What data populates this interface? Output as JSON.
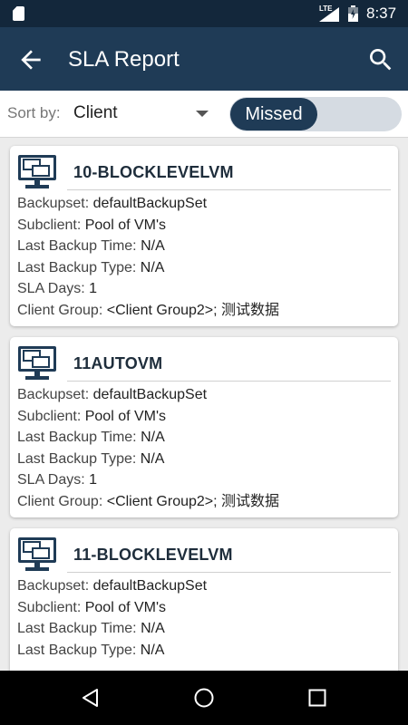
{
  "status_bar": {
    "network": "LTE",
    "time": "8:37"
  },
  "header": {
    "title": "SLA Report",
    "back_icon": "arrow-left-icon",
    "search_icon": "search-icon"
  },
  "sort": {
    "label": "Sort by:",
    "value": "Client",
    "toggle_label": "Missed"
  },
  "colors": {
    "primary": "#1f3b56",
    "status_bar": "#13273b",
    "toggle_track": "#d5dbe2"
  },
  "labels": {
    "backupset": "Backupset:",
    "subclient": "Subclient:",
    "last_backup_time": "Last Backup Time:",
    "last_backup_type": "Last Backup Type:",
    "sla_days": "SLA Days:",
    "client_group": "Client Group:"
  },
  "cards": [
    {
      "name": "10-BLOCKLEVELVM",
      "backupset": "defaultBackupSet",
      "subclient": "Pool of VM's",
      "last_backup_time": "N/A",
      "last_backup_type": "N/A",
      "sla_days": "1",
      "client_group": "<Client Group2>; 测试数据"
    },
    {
      "name": "11AUTOVM",
      "backupset": "defaultBackupSet",
      "subclient": "Pool of VM's",
      "last_backup_time": "N/A",
      "last_backup_type": "N/A",
      "sla_days": "1",
      "client_group": "<Client Group2>; 测试数据"
    },
    {
      "name": "11-BLOCKLEVELVM",
      "backupset": "defaultBackupSet",
      "subclient": "Pool of VM's",
      "last_backup_time": "N/A",
      "last_backup_type": "N/A"
    }
  ]
}
